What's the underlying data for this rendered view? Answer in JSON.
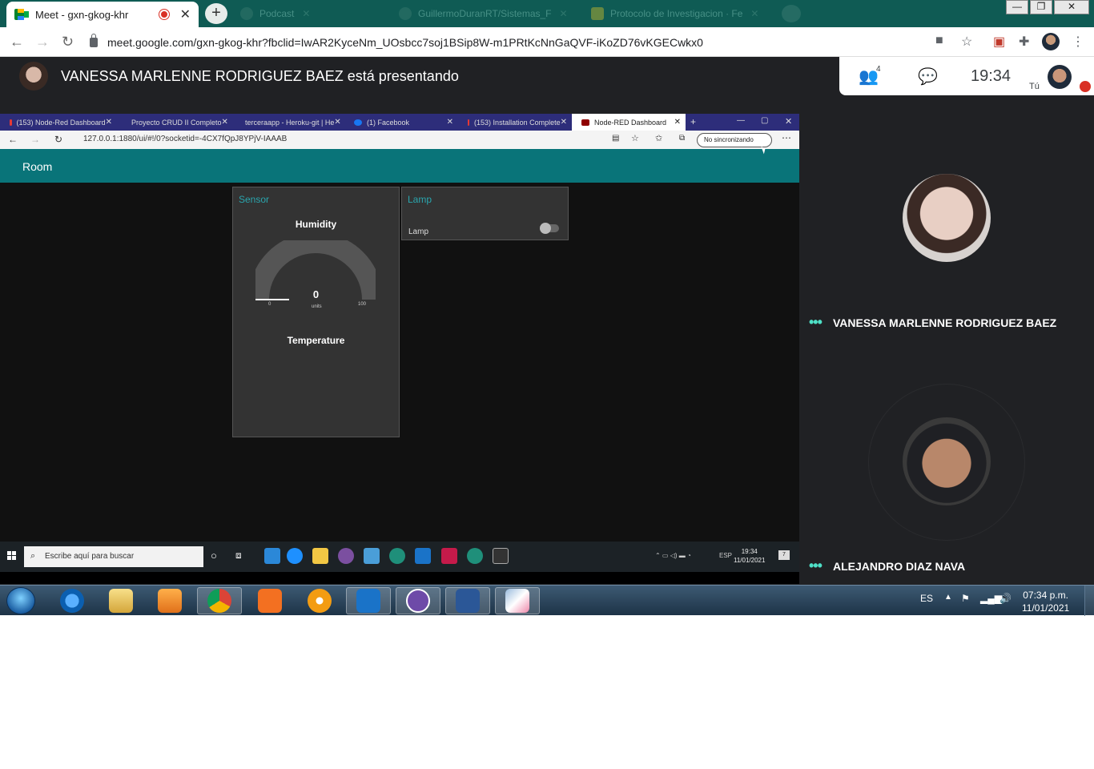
{
  "browser": {
    "active_tab_title": "Meet - gxn-gkog-khr",
    "new_tab_label": "+",
    "tab_close": "✕",
    "bg_tabs": [
      "Podcast",
      "GuillermoDuranRT/Sistemas_F",
      "Protocolo de Investigacion · Fe"
    ],
    "url": "meet.google.com/gxn-gkog-khr?fbclid=IwAR2KyceNm_UOsbcc7soj1BSip8W-m1PRtKcNnGaQVF-iKoZD76vKGECwkx0",
    "win_min": "—",
    "win_max": "❐",
    "win_close": "✕"
  },
  "meet": {
    "presenting_text": "VANESSA MARLENNE RODRIGUEZ BAEZ está presentando",
    "participants_count": "4",
    "time": "19:34",
    "self_label": "Tú",
    "participants": [
      {
        "name": "VANESSA MARLENNE RODRIGUEZ BAEZ"
      },
      {
        "name": "ALEJANDRO DIAZ NAVA"
      }
    ]
  },
  "shared_screen": {
    "tabs": [
      "(153) Node-Red Dashboard",
      "Proyecto CRUD II Completo",
      "terceraapp - Heroku-git | He",
      "(1) Facebook",
      "(153) Installation Complete",
      "Node-RED Dashboard"
    ],
    "url": "127.0.0.1:1880/ui/#!/0?socketid=-4CX7fQpJ8YPjV-IAAAB",
    "sync_label": "No sincronizando",
    "dashboard_title": "Room",
    "sensor_card": {
      "title": "Sensor",
      "humidity_label": "Humidity",
      "humidity_value": "0",
      "units": "units",
      "min": "0",
      "max": "100",
      "temperature_label": "Temperature"
    },
    "lamp_card": {
      "title": "Lamp",
      "switch_label": "Lamp",
      "switch_on": false
    },
    "taskbar": {
      "search_placeholder": "Escribe aquí para buscar",
      "lang": "ESP",
      "time": "19:34",
      "date": "11/01/2021",
      "notifications": "7"
    }
  },
  "os_taskbar": {
    "lang": "ES",
    "time": "07:34 p.m.",
    "date": "11/01/2021"
  }
}
